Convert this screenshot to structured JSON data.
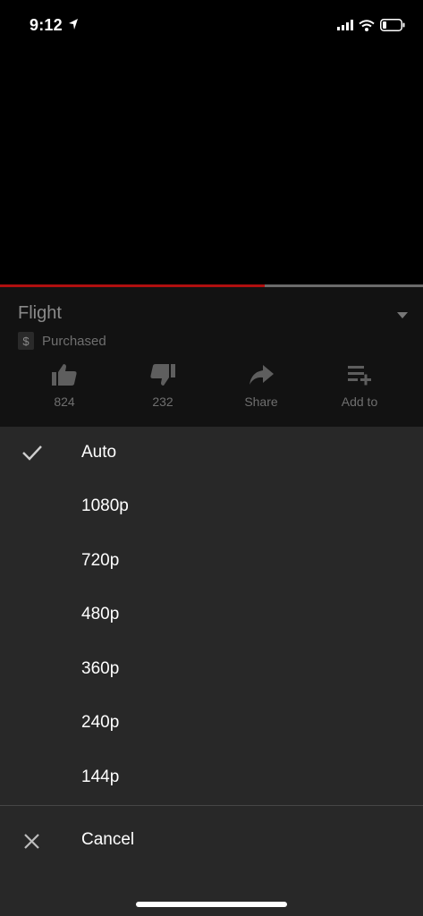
{
  "status_bar": {
    "time": "9:12",
    "location_icon": "location-arrow-icon",
    "signal_icon": "cellular-signal-icon",
    "wifi_icon": "wifi-icon",
    "battery_icon": "battery-icon"
  },
  "progress": {
    "played_fraction": 0.625,
    "played_color": "#b00f0f",
    "track_color": "#6b6b6b"
  },
  "video": {
    "title": "Flight",
    "purchase_badge": "$",
    "purchase_status": "Purchased"
  },
  "actions": [
    {
      "icon": "thumbs-up-icon",
      "label": "824"
    },
    {
      "icon": "thumbs-down-icon",
      "label": "232"
    },
    {
      "icon": "share-icon",
      "label": "Share"
    },
    {
      "icon": "add-to-playlist-icon",
      "label": "Add to"
    }
  ],
  "quality_menu": {
    "selected": "Auto",
    "options": [
      "Auto",
      "1080p",
      "720p",
      "480p",
      "360p",
      "240p",
      "144p"
    ],
    "cancel_label": "Cancel"
  },
  "colors": {
    "sheet_bg": "#282828",
    "info_bg": "#121212",
    "muted_text": "#6f6f6f"
  }
}
